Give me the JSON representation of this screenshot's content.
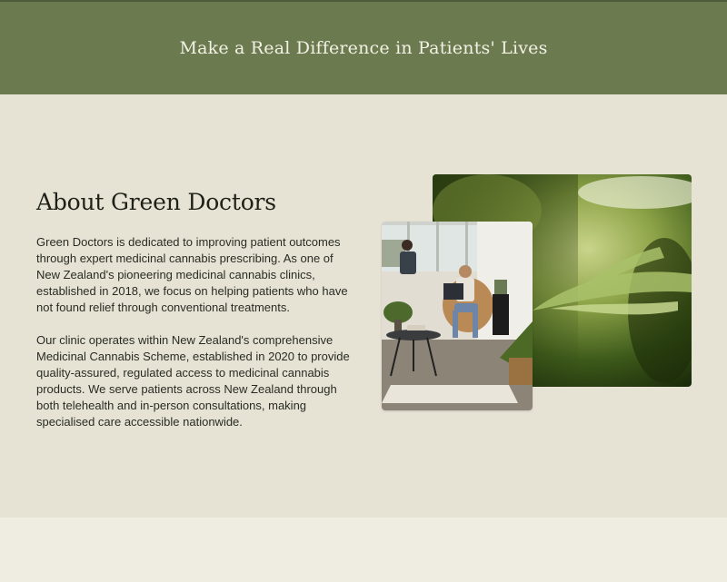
{
  "banner": {
    "title": "Make a Real Difference in Patients' Lives"
  },
  "about": {
    "heading": "About Green Doctors",
    "paragraphs": [
      "Green Doctors is dedicated to improving patient outcomes through expert medicinal cannabis prescribing. As one of New Zealand's pioneering medicinal cannabis clinics, established in 2018, we focus on helping patients who have not found relief through conventional treatments.",
      "Our clinic operates within New Zealand's comprehensive Medicinal Cannabis Scheme, established in 2020 to provide quality-assured, regulated access to medicinal cannabis products. We serve patients across New Zealand through both telehealth and in-person consultations, making specialised care accessible nationwide."
    ]
  },
  "images": {
    "leaf": "cannabis-leaf-photo",
    "room": "clinic-waiting-room-photo"
  },
  "colors": {
    "banner_bg": "#6b7a4f",
    "section_bg": "#e6e3d5",
    "page_bg": "#efede2"
  }
}
